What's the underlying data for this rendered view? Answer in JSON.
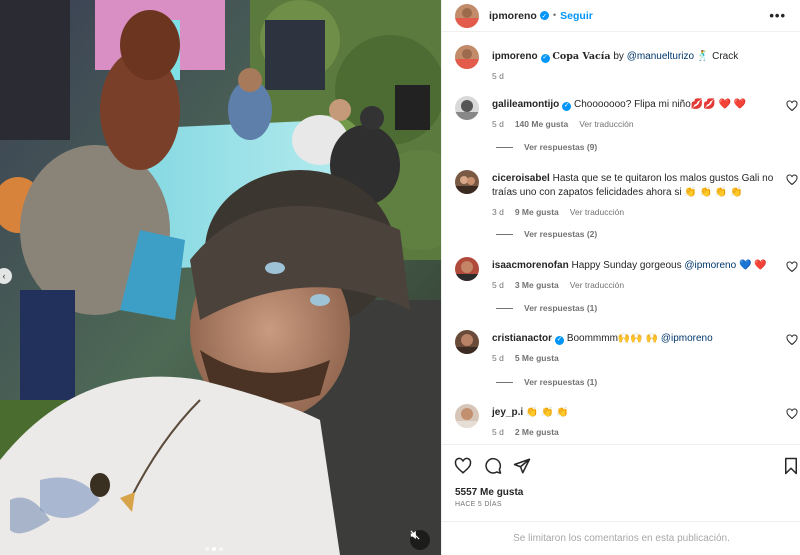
{
  "post": {
    "username": "ipmoreno",
    "follow_label": "Seguir",
    "more_label": "•••",
    "caption": {
      "username": "ipmoreno",
      "song": "Copa Vacía",
      "by": "by",
      "artist": "@manuelturizo",
      "emoji": "🕺",
      "text": "Crack",
      "time": "5 d"
    }
  },
  "comments": [
    {
      "username": "galileamontijo",
      "verified": true,
      "text": "Chooooooo? Flipa mi niño💋💋 ❤️ ❤️",
      "time": "5 d",
      "likes": "140 Me gusta",
      "translate": "Ver traducción",
      "replies": "Ver respuestas (9)"
    },
    {
      "username": "ciceroisabel",
      "verified": false,
      "text": "Hasta que se te quitaron los malos gustos Gali no traías uno con zapatos felicidades ahora si 👏 👏 👏 👏",
      "time": "3 d",
      "likes": "9 Me gusta",
      "translate": "Ver traducción",
      "replies": "Ver respuestas (2)"
    },
    {
      "username": "isaacmorenofan",
      "verified": false,
      "text": "Happy Sunday gorgeous",
      "mention": "@ipmoreno",
      "suffix": "💙 ❤️",
      "time": "5 d",
      "likes": "3 Me gusta",
      "translate": "Ver traducción",
      "replies": "Ver respuestas (1)"
    },
    {
      "username": "cristianactor",
      "verified": true,
      "text": "Boommmm🙌🙌 🙌",
      "mention": "@ipmoreno",
      "time": "5 d",
      "likes": "5 Me gusta",
      "replies": "Ver respuestas (1)"
    },
    {
      "username": "jey_p.i",
      "verified": false,
      "text": "👏 👏 👏",
      "time": "5 d",
      "likes": "2 Me gusta"
    }
  ],
  "footer": {
    "likes": "5557 Me gusta",
    "ago": "HACE 5 DÍAS",
    "comments_closed": "Se limitaron los comentarios en esta publicación."
  },
  "icons": {
    "like": "heart-icon",
    "comment": "comment-icon",
    "share": "share-icon",
    "save": "bookmark-icon",
    "mute": "speaker-muted-icon"
  }
}
